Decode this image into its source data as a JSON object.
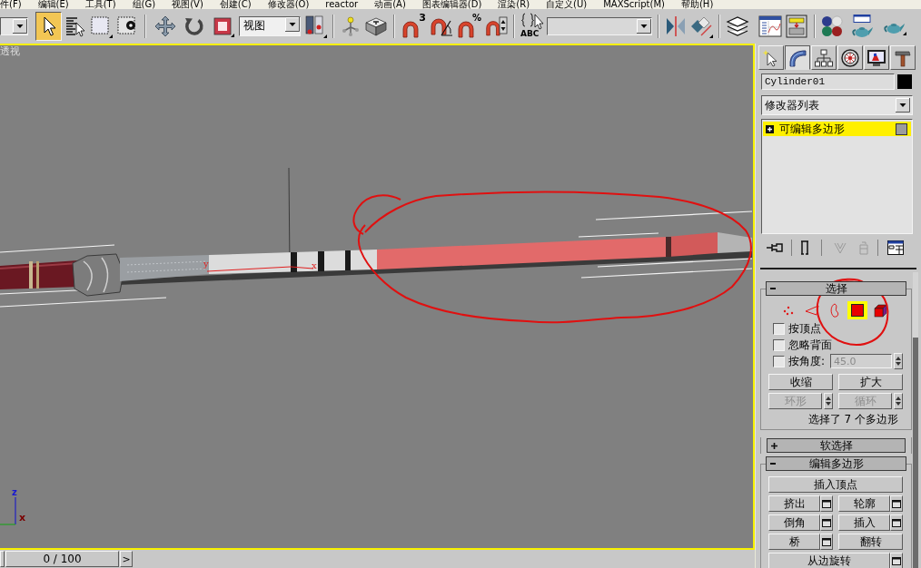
{
  "menu_bar": [
    "件(F)",
    "编辑(E)",
    "工具(T)",
    "组(G)",
    "视图(V)",
    "创建(C)",
    "修改器(O)",
    "reactor",
    "动画(A)",
    "图表编辑器(D)",
    "渲染(R)",
    "自定义(U)",
    "MAXScript(M)",
    "帮助(H)"
  ],
  "toolbar": {
    "tools": [
      {
        "selected": true
      },
      {
        "selected": false
      },
      {
        "selected": false
      },
      {
        "selected": false
      }
    ],
    "reference_coordinate": "视图",
    "snap_badges": [
      "3",
      "%"
    ],
    "selection_sets_icon_caption": "ABC"
  },
  "viewport": {
    "label": "透视",
    "active": true,
    "gizmo_labels": [
      "y",
      "x"
    ],
    "axis_tripod_labels": [
      "z",
      "x"
    ]
  },
  "time_slider": {
    "frame": "0 / 100",
    "level": 0,
    "next": ">"
  },
  "command_panel": {
    "tabs": [
      {
        "selected": false
      },
      {
        "selected": true
      },
      {
        "selected": false
      },
      {
        "selected": false
      },
      {
        "selected": false
      },
      {
        "selected": false
      }
    ],
    "object_name": "Cylinder01",
    "modifier_list": "修改器列表",
    "modifier_stack": [
      {
        "label": "可编辑多边形",
        "selected": true,
        "expanded": false
      }
    ],
    "stack_tools": [
      {
        "disabled": false
      },
      {
        "disabled": false
      },
      {
        "disabled": true
      },
      {
        "disabled": true
      },
      {
        "disabled": false
      }
    ],
    "rollouts": [
      {
        "kind": "selection",
        "title": "选择",
        "expanded": true,
        "subobject_levels": [
          {
            "selected": false
          },
          {
            "selected": false
          },
          {
            "selected": false
          },
          {
            "selected": true
          },
          {
            "selected": false
          }
        ],
        "options": [
          {
            "label": "按顶点",
            "checked": false
          },
          {
            "label": "忽略背面",
            "checked": false
          },
          {
            "label": "按角度:",
            "checked": false,
            "field": {
              "value": "45.0",
              "disabled": true
            }
          }
        ],
        "buttons": [
          {
            "label": "收缩",
            "kind": "plain",
            "disabled": false
          },
          {
            "label": "扩大",
            "kind": "plain",
            "disabled": false
          },
          {
            "label": "环形",
            "kind": "spinner",
            "disabled": true
          },
          {
            "label": "循环",
            "kind": "spinner",
            "disabled": true
          }
        ],
        "status": "选择了 7 个多边形"
      },
      {
        "kind": "soft_selection",
        "title": "软选择",
        "expanded": false
      },
      {
        "kind": "edit_polygons",
        "title": "编辑多边形",
        "expanded": true,
        "buttons": [
          {
            "label": "插入顶点",
            "kind": "wide"
          },
          {
            "label": "挤出",
            "kind": "settings"
          },
          {
            "label": "轮廓",
            "kind": "settings"
          },
          {
            "label": "倒角",
            "kind": "settings"
          },
          {
            "label": "插入",
            "kind": "settings"
          },
          {
            "label": "桥",
            "kind": "settings"
          },
          {
            "label": "翻转",
            "kind": "plain"
          },
          {
            "label": "从边旋转",
            "kind": "wide_settings"
          }
        ]
      }
    ]
  }
}
